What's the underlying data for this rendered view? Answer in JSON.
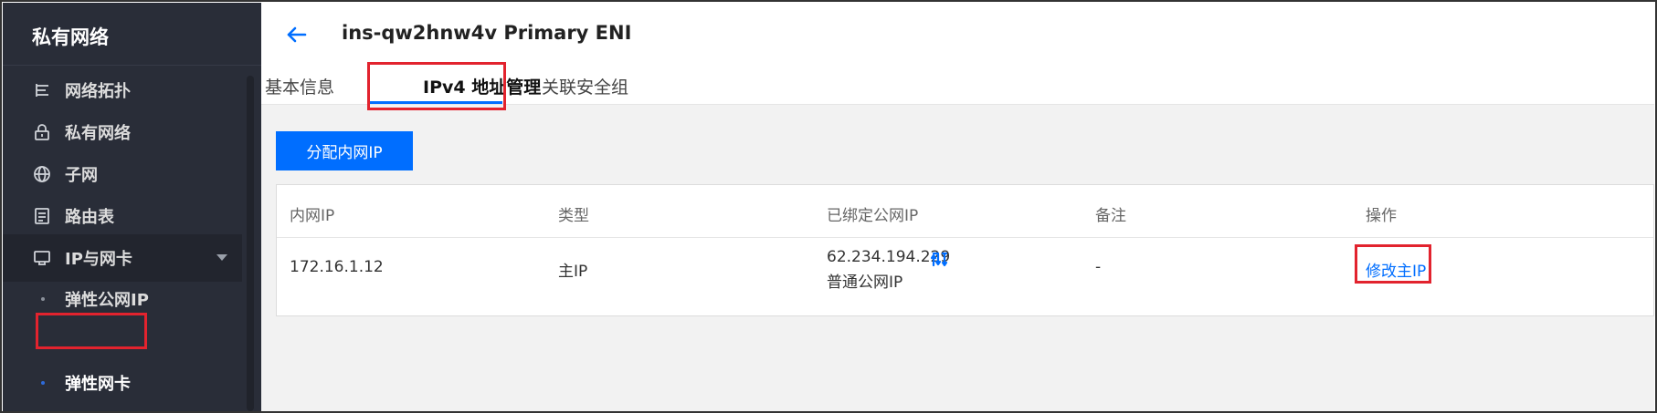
{
  "sidebar": {
    "title": "私有网络",
    "items": [
      {
        "label": "网络拓扑",
        "icon": "topology-icon"
      },
      {
        "label": "私有网络",
        "icon": "lock-icon"
      },
      {
        "label": "子网",
        "icon": "globe-icon"
      },
      {
        "label": "路由表",
        "icon": "route-table-icon"
      },
      {
        "label": "IP与网卡",
        "icon": "ip-nic-icon"
      }
    ],
    "sub_items": [
      {
        "label": "弹性公网IP"
      },
      {
        "label": "弹性网卡"
      }
    ]
  },
  "header": {
    "title": "ins-qw2hnw4v Primary ENI",
    "tabs": [
      {
        "label": "基本信息"
      },
      {
        "label": "IPv4 地址管理"
      },
      {
        "label": "关联安全组"
      }
    ]
  },
  "toolbar": {
    "assign_label": "分配内网IP"
  },
  "table": {
    "columns": [
      "内网IP",
      "类型",
      "已绑定公网IP",
      "备注",
      "操作"
    ],
    "rows": [
      {
        "private_ip": "172.16.1.12",
        "type": "主IP",
        "public_ip": "62.234.194.229",
        "public_ip_type": "普通公网IP",
        "remark": "-",
        "action": "修改主IP"
      }
    ]
  },
  "colors": {
    "accent": "#006eff",
    "highlight": "#e2232e",
    "sidebar_bg": "#292d38"
  }
}
